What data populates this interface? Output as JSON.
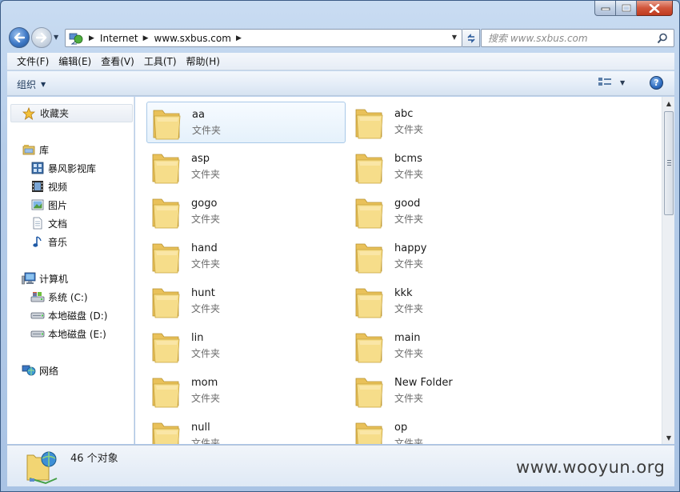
{
  "window": {
    "caption_buttons": [
      "minimize",
      "maximize",
      "close"
    ]
  },
  "address_bar": {
    "crumbs": [
      "Internet",
      "www.sxbus.com"
    ],
    "icon": "network-globe-icon"
  },
  "search": {
    "placeholder": "搜索 www.sxbus.com"
  },
  "menu": {
    "items": [
      "文件(F)",
      "编辑(E)",
      "查看(V)",
      "工具(T)",
      "帮助(H)"
    ]
  },
  "toolbar": {
    "organize_label": "组织"
  },
  "navpane": {
    "favorites": "收藏夹",
    "library": "库",
    "library_items": [
      "暴风影视库",
      "视频",
      "图片",
      "文档",
      "音乐"
    ],
    "computer": "计算机",
    "drives": [
      "系统 (C:)",
      "本地磁盘 (D:)",
      "本地磁盘 (E:)"
    ],
    "network": "网络"
  },
  "content": {
    "folder_type": "文件夹",
    "folders": [
      "aa",
      "abc",
      "asp",
      "bcms",
      "gogo",
      "good",
      "hand",
      "happy",
      "hunt",
      "kkk",
      "lin",
      "main",
      "mom",
      "New Folder",
      "null",
      "op"
    ],
    "selected_index": 0
  },
  "details": {
    "count_text": "46 个对象"
  },
  "watermark": "www.wooyun.org",
  "colors": {
    "folder_yellow": "#f2d573",
    "accent_blue": "#2e6cc0",
    "close_red": "#c03a1f"
  }
}
